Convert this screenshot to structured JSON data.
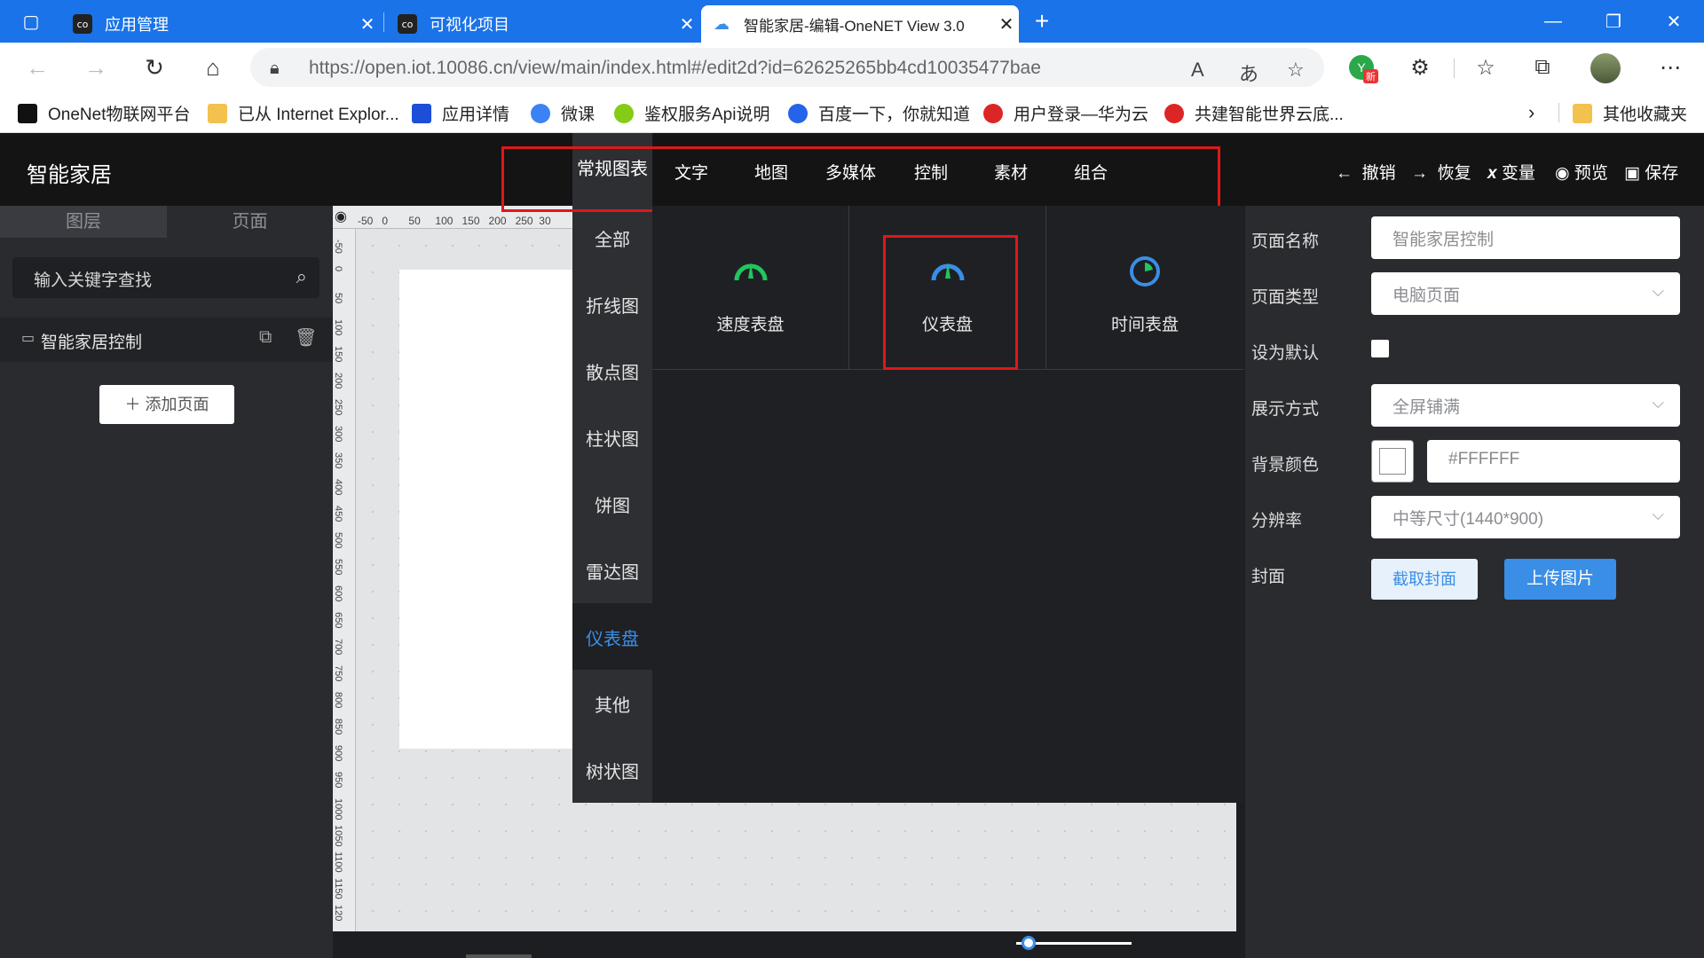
{
  "browser": {
    "tabs": [
      {
        "title": "应用管理",
        "icon": "onenet-icon"
      },
      {
        "title": "可视化项目",
        "icon": "onenet-icon"
      },
      {
        "title": "智能家居-编辑-OneNET View 3.0",
        "icon": "cloud-icon",
        "active": true
      }
    ],
    "url": "https://open.iot.10086.cn/view/main/index.html#/edit2d?id=62625265bb4cd10035477bae",
    "bookmarks": [
      "OneNet物联网平台",
      "已从 Internet Explor...",
      "应用详情",
      "微课",
      "鉴权服务Api说明",
      "百度一下，你就知道",
      "用户登录—华为云",
      "共建智能世界云底..."
    ],
    "other_favorites": "其他收藏夹",
    "profile_badge": "新"
  },
  "app": {
    "brand": "智能家居",
    "toolbar": {
      "undo": "撤销",
      "redo": "恢复",
      "variables": "变量",
      "preview": "预览",
      "save": "保存"
    },
    "top_tabs": [
      "常规图表",
      "文字",
      "地图",
      "多媒体",
      "控制",
      "素材",
      "组合"
    ],
    "left": {
      "tab_layers": "图层",
      "tab_pages": "页面",
      "search_placeholder": "输入关键字查找",
      "page_item": "智能家居控制",
      "add_page": "添加页面"
    },
    "chart_categories": [
      "全部",
      "折线图",
      "散点图",
      "柱状图",
      "饼图",
      "雷达图",
      "仪表盘",
      "其他",
      "树状图"
    ],
    "selected_category": "仪表盘",
    "gauges": [
      "速度表盘",
      "仪表盘",
      "时间表盘"
    ],
    "ruler_h": [
      "-50",
      "0",
      "50",
      "100",
      "150",
      "200",
      "250",
      "30"
    ],
    "ruler_v": [
      "-50",
      "0",
      "50",
      "100",
      "150",
      "200",
      "250",
      "300",
      "350",
      "400",
      "450",
      "500",
      "550",
      "600",
      "650",
      "700",
      "750",
      "800",
      "850",
      "900",
      "950",
      "1000",
      "1050",
      "1100",
      "1150",
      "120"
    ],
    "right": {
      "page_name_label": "页面名称",
      "page_name": "智能家居控制",
      "page_type_label": "页面类型",
      "page_type": "电脑页面",
      "default_label": "设为默认",
      "display_label": "展示方式",
      "display": "全屏铺满",
      "bg_label": "背景颜色",
      "bg": "#FFFFFF",
      "res_label": "分辨率",
      "res": "中等尺寸(1440*900)",
      "cover_label": "封面",
      "capture": "截取封面",
      "upload": "上传图片"
    }
  },
  "colors": {
    "accent": "#3a8ee6",
    "highlight": "#e01717",
    "gauge_green": "#22c55e"
  }
}
